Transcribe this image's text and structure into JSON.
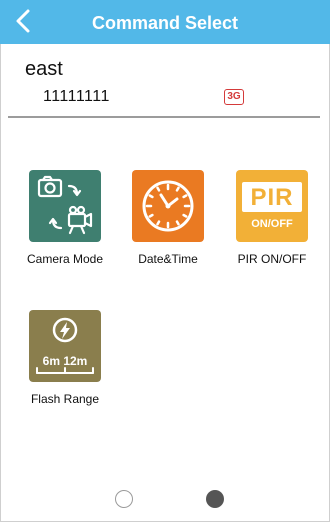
{
  "header": {
    "title": "Command Select",
    "back_icon": "chevron-left-icon",
    "color": "#52b8e8"
  },
  "device": {
    "name": "east",
    "id": "11111111",
    "network_badge": "3G"
  },
  "commands": [
    {
      "label": "Camera Mode",
      "icon": "camera-video-switch-icon",
      "color": "#3f7f70"
    },
    {
      "label": "Date&Time",
      "icon": "clock-icon",
      "color": "#ea7a22"
    },
    {
      "label": "PIR ON/OFF",
      "icon": "pir-icon",
      "icon_text": "PIR",
      "icon_subtext": "ON/OFF",
      "color": "#f2b037"
    },
    {
      "label": "Flash Range",
      "icon": "flash-range-icon",
      "icon_text": "6m 12m",
      "color": "#8a7e4d"
    }
  ],
  "pager": {
    "pages": 2,
    "current": 2
  }
}
